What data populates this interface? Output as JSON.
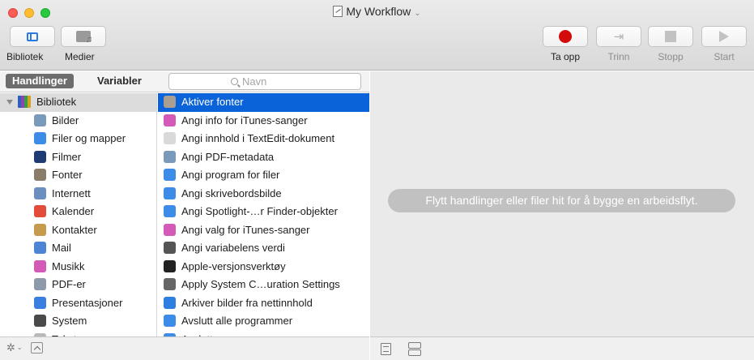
{
  "window": {
    "title": "My Workflow",
    "title_chevron": "⌄"
  },
  "toolbar": {
    "library_label": "Bibliotek",
    "media_label": "Medier",
    "record_label": "Ta opp",
    "step_label": "Trinn",
    "stop_label": "Stopp",
    "run_label": "Start"
  },
  "library_tabs": {
    "actions_label": "Handlinger",
    "variables_label": "Variabler",
    "search_placeholder": "Navn"
  },
  "categories": [
    {
      "label": "Bibliotek",
      "icon": "library-icon",
      "color": "#3a6fc9"
    },
    {
      "label": "Bilder",
      "icon": "photos-icon",
      "color": "#7a9abb"
    },
    {
      "label": "Filer og mapper",
      "icon": "finder-icon",
      "color": "#3d8de8"
    },
    {
      "label": "Filmer",
      "icon": "quicktime-icon",
      "color": "#1e3c73"
    },
    {
      "label": "Fonter",
      "icon": "font-book-icon",
      "color": "#8a7d6a"
    },
    {
      "label": "Internett",
      "icon": "globe-icon",
      "color": "#6a8fc0"
    },
    {
      "label": "Kalender",
      "icon": "calendar-icon",
      "color": "#e34b3a"
    },
    {
      "label": "Kontakter",
      "icon": "contacts-icon",
      "color": "#c79b4e"
    },
    {
      "label": "Mail",
      "icon": "mail-icon",
      "color": "#4e84d6"
    },
    {
      "label": "Musikk",
      "icon": "itunes-icon",
      "color": "#d45ab8"
    },
    {
      "label": "PDF-er",
      "icon": "pdf-icon",
      "color": "#8d9aaa"
    },
    {
      "label": "Presentasjoner",
      "icon": "presentation-icon",
      "color": "#3a7ee0"
    },
    {
      "label": "System",
      "icon": "system-icon",
      "color": "#4a4a4a"
    },
    {
      "label": "Tekst",
      "icon": "text-icon",
      "color": "#b9b9b9"
    }
  ],
  "actions": [
    {
      "label": "Aktiver fonter",
      "icon": "font-book-icon",
      "color": "#a89f92"
    },
    {
      "label": "Angi info for iTunes-sanger",
      "icon": "itunes-icon",
      "color": "#d45ab8"
    },
    {
      "label": "Angi innhold i TextEdit-dokument",
      "icon": "textedit-icon",
      "color": "#d9d9d9"
    },
    {
      "label": "Angi PDF-metadata",
      "icon": "preview-icon",
      "color": "#7a9abb"
    },
    {
      "label": "Angi program for filer",
      "icon": "finder-icon",
      "color": "#3d8de8"
    },
    {
      "label": "Angi skrivebordsbilde",
      "icon": "finder-icon",
      "color": "#3d8de8"
    },
    {
      "label": "Angi Spotlight-…r Finder-objekter",
      "icon": "finder-icon",
      "color": "#3d8de8"
    },
    {
      "label": "Angi valg for iTunes-sanger",
      "icon": "itunes-icon",
      "color": "#d45ab8"
    },
    {
      "label": "Angi variabelens verdi",
      "icon": "automator-icon",
      "color": "#555555"
    },
    {
      "label": "Apple-versjonsverktøy",
      "icon": "terminal-icon",
      "color": "#222222"
    },
    {
      "label": "Apply System C…uration Settings",
      "icon": "automator-icon",
      "color": "#666666"
    },
    {
      "label": "Arkiver bilder fra nettinnhold",
      "icon": "safari-icon",
      "color": "#2f7fe0"
    },
    {
      "label": "Avslutt alle programmer",
      "icon": "finder-icon",
      "color": "#3d8de8"
    },
    {
      "label": "Avslutt …",
      "icon": "finder-icon",
      "color": "#3d8de8"
    }
  ],
  "workflow": {
    "hint": "Flytt handlinger eller filer hit for å bygge en arbeidsflyt."
  },
  "footer": {
    "gear_glyph": "✲",
    "gear_chevron": "⌄"
  }
}
